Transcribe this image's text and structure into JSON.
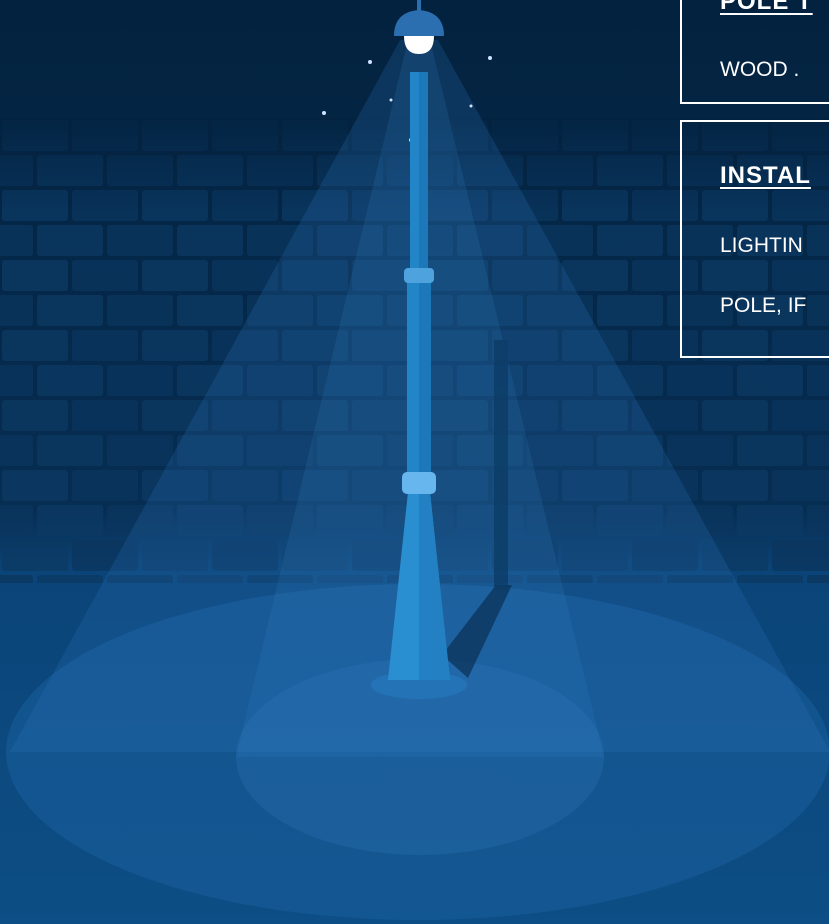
{
  "panels": {
    "pole_type": {
      "heading": "POLE T",
      "value": "WOOD ."
    },
    "installation": {
      "heading": "INSTAL",
      "line1": "LIGHTIN",
      "line2": "POLE, IF"
    }
  },
  "colors": {
    "background_top": "#03223f",
    "background_bottom": "#0c4e85",
    "brick_wall": "#0a355e",
    "light_cone": "#2d78bf",
    "pole": "#2185c7",
    "lamp_shade": "#2b6fb1",
    "bulb": "#ffffff",
    "text": "#ffffff"
  },
  "icons": [
    "street-lamp-illustration",
    "brick-wall-illustration",
    "star-icon"
  ]
}
